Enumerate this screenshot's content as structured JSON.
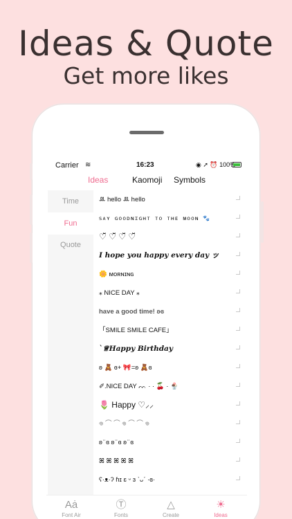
{
  "promo": {
    "headline": "Ideas & Quote",
    "subline": "Get more likes"
  },
  "statusbar": {
    "carrier": "Carrier",
    "wifi_icon": "≋",
    "time": "16:23",
    "indicators": "◉ ➚ ⏰ 100%"
  },
  "tabs": {
    "ideas": "Ideas",
    "kaomoji": "Kaomoji",
    "symbols": "Symbols"
  },
  "sidebar": {
    "time": "Time",
    "fun": "Fun",
    "quote": "Quote"
  },
  "rows": [
    "ꔛ hello ꔛ hello",
    "ꜱᴀʏ ɢᴏᴏᴅɴɪɢʜᴛ ᴛᴏ ᴛʜᴇ ᴍᴏᴏɴ  🐾",
    "♡̆̈ ♡̆̈ ♡̆̈ ♡̆̈",
    "I hope you happy every day   ッ",
    "🌼  ᴍᴏʀɴɪɴɢ",
    "⁎ NICE DAY ⁎",
    "have a good time!  ʚɞ",
    "「SMILE SMILE CAFE」",
    "ˋ♕Happy Birthday",
    "ʚ 🧸 ɞ+ 🎀=ʚ 🧸ɞ",
    "✐.NICE DAY ᨓ  ·  · 🍒 · 🍨",
    "🌷    Happy   ♡⸝⸝",
    "𖦹 ⌒ ⌒ 𖦹 ⌒ ⌒ 𖦹",
    "ʚ ̈ ɞ ʚ ̈ ɞ ʚ ̈ ɞ",
    "ꕤ ꕤ ꕤ ꕤ ꕤ",
    "ʕ·ᴥ·ʔ  ɦɪ  ɛ ᵕ ɜ  ˋᴗˊ  ·ɞ·"
  ],
  "bottomnav": {
    "font_air": "Font Air",
    "fonts": "Fonts",
    "create": "Create",
    "ideas": "Ideas"
  },
  "colors": {
    "background": "#fde0e0",
    "accent": "#ef6b8f",
    "text": "#3a3030"
  },
  "icons": {
    "font_air": "font-air-icon",
    "fonts": "fonts-icon",
    "create": "create-icon",
    "ideas": "lightbulb-icon"
  }
}
